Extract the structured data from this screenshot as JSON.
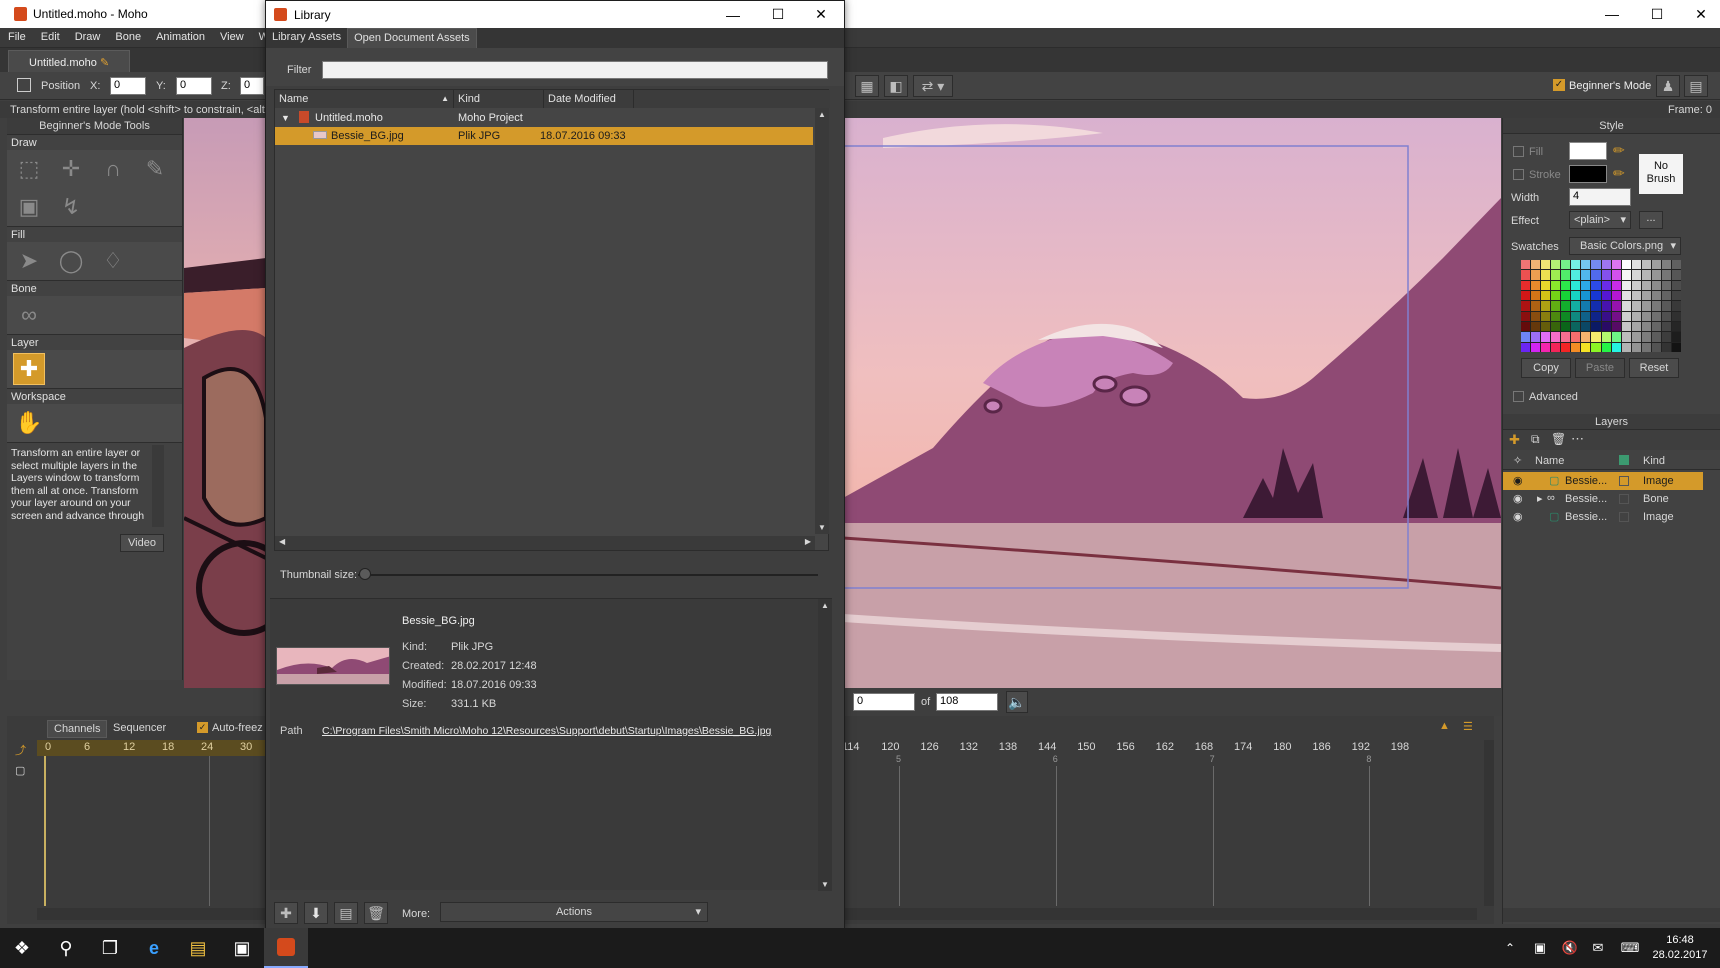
{
  "main_window": {
    "title": "Untitled.moho - Moho"
  },
  "menu": [
    "File",
    "Edit",
    "Draw",
    "Bone",
    "Animation",
    "View",
    "W"
  ],
  "doc_tab": "Untitled.moho",
  "options": {
    "position_label": "Position",
    "x_label": "X:",
    "x_value": "0",
    "y_label": "Y:",
    "y_value": "0",
    "z_label": "Z:",
    "z_value": "0",
    "beginners_mode": "Beginner's Mode",
    "beginners_mode_checked": true
  },
  "status": {
    "hint": "Transform entire layer (hold <shift> to constrain, <alt",
    "frame": "Frame: 0"
  },
  "tools": {
    "header": "Beginner's Mode Tools",
    "sections": {
      "draw": "Draw",
      "fill": "Fill",
      "bone": "Bone",
      "layer": "Layer",
      "workspace": "Workspace"
    },
    "description": "Transform an entire layer or select multiple layers in the Layers window to transform them all at once. Transform your layer around on your screen and advance through",
    "video_button": "Video"
  },
  "style": {
    "header": "Style",
    "fill_label": "Fill",
    "stroke_label": "Stroke",
    "width_label": "Width",
    "width_value": "4",
    "effect_label": "Effect",
    "effect_value": "<plain>",
    "effect_more": "...",
    "no_brush": "No Brush",
    "fill_color": "#ffffff",
    "stroke_color": "#000000",
    "swatches_label": "Swatches",
    "swatches_value": "Basic Colors.png",
    "copy": "Copy",
    "paste": "Paste",
    "reset": "Reset",
    "advanced": "Advanced"
  },
  "layers": {
    "header": "Layers",
    "col_name": "Name",
    "col_kind": "Kind",
    "rows": [
      {
        "name": "Bessie...",
        "kind": "Image",
        "selected": true
      },
      {
        "name": "Bessie...",
        "kind": "Bone",
        "selected": false
      },
      {
        "name": "Bessie...",
        "kind": "Image",
        "selected": false
      }
    ]
  },
  "timeline": {
    "tabs": [
      "Channels",
      "Sequencer"
    ],
    "auto_freeze": "Auto-freez",
    "left_ticks": [
      "0",
      "6",
      "12",
      "18",
      "24",
      "30"
    ],
    "right_ticks": [
      "114",
      "120",
      "126",
      "132",
      "138",
      "144",
      "150",
      "156",
      "162",
      "168",
      "174",
      "180",
      "186",
      "192",
      "198"
    ],
    "second_marks": [
      "5",
      "6",
      "7",
      "8"
    ],
    "frame_value": "0",
    "of_label": "of",
    "total_frames": "108"
  },
  "library": {
    "title": "Library",
    "tabs": [
      "Library Assets",
      "Open Document Assets"
    ],
    "filter_label": "Filter",
    "filter_value": "",
    "columns": [
      "Name",
      "Kind",
      "Date Modified"
    ],
    "rows": [
      {
        "name": "Untitled.moho",
        "kind": "Moho Project",
        "date": "",
        "selected": false
      },
      {
        "name": "Bessie_BG.jpg",
        "kind": "Plik JPG",
        "date": "18.07.2016 09:33",
        "selected": true
      }
    ],
    "thumbnail_label": "Thumbnail size:",
    "details": {
      "filename": "Bessie_BG.jpg",
      "kind_label": "Kind:",
      "kind_value": "Plik JPG",
      "created_label": "Created:",
      "created_value": "28.02.2017 12:48",
      "modified_label": "Modified:",
      "modified_value": "18.07.2016 09:33",
      "size_label": "Size:",
      "size_value": "331.1 KB",
      "path_label": "Path",
      "path_value": "C:\\Program Files\\Smith Micro\\Moho 12\\Resources\\Support\\debut\\Startup\\Images\\Bessie_BG.jpg"
    },
    "more_label": "More:",
    "actions_value": "Actions"
  },
  "taskbar": {
    "time": "16:48",
    "date": "28.02.2017"
  }
}
